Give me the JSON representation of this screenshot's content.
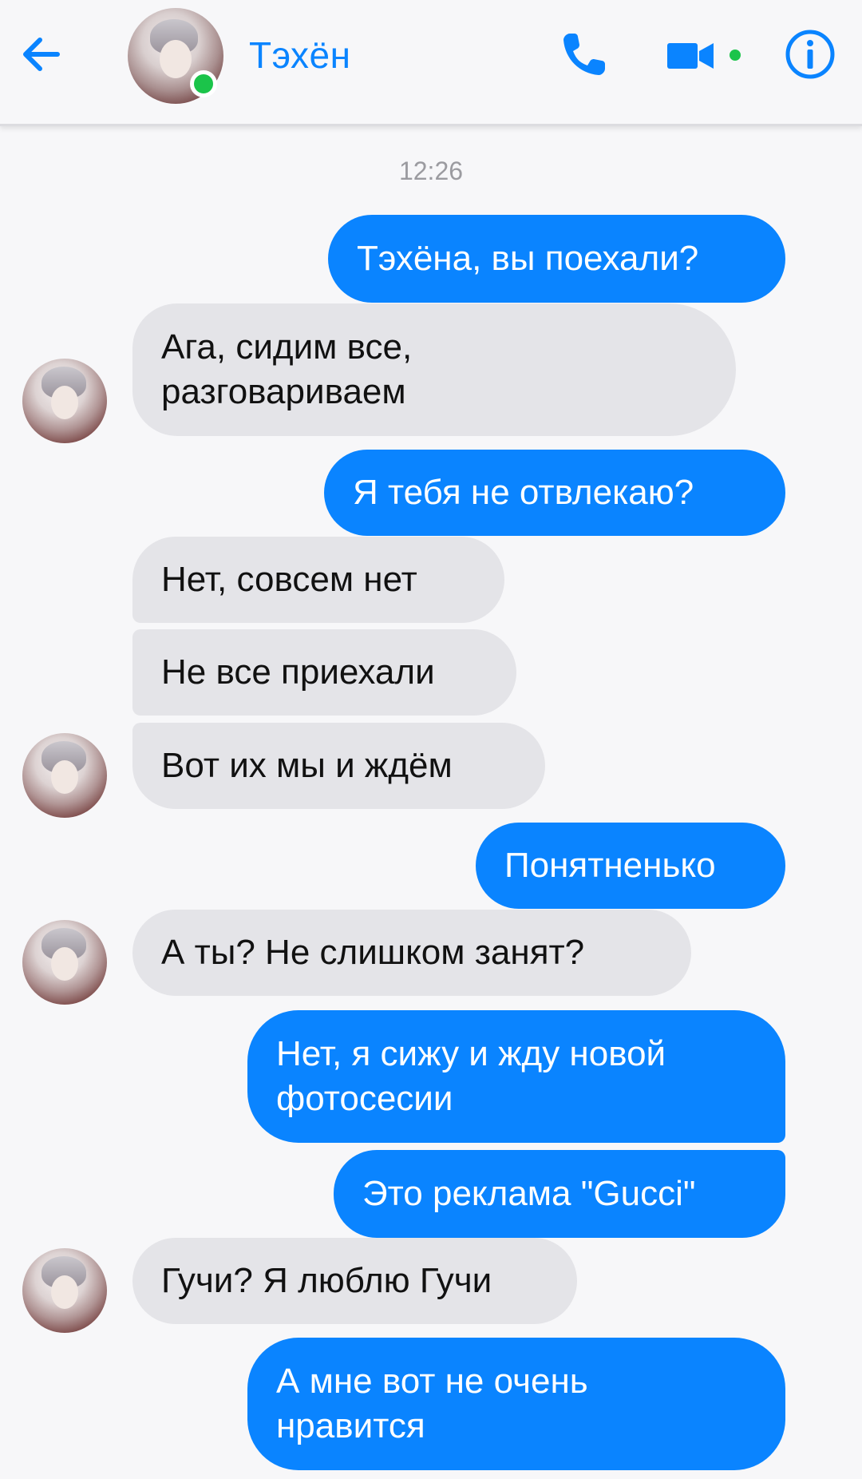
{
  "header": {
    "contact_name": "Тэхён",
    "online": true
  },
  "colors": {
    "accent": "#0a84ff",
    "outgoing_bubble": "#0a84ff",
    "incoming_bubble": "#e4e4e8",
    "online": "#1bc44a"
  },
  "icons": {
    "back": "arrow-left-icon",
    "call": "phone-icon",
    "video": "video-camera-icon",
    "info": "info-icon"
  },
  "chat": {
    "timestamp": "12:26",
    "messages": [
      {
        "from": "me",
        "text": "Тэхёна, вы поехали?"
      },
      {
        "from": "contact",
        "text": "Ага, сидим все,\nразговариваем"
      },
      {
        "from": "me",
        "text": "Я тебя не отвлекаю?"
      },
      {
        "from": "contact",
        "text": "Нет, совсем нет"
      },
      {
        "from": "contact",
        "text": "Не все приехали"
      },
      {
        "from": "contact",
        "text": "Вот их мы и ждём"
      },
      {
        "from": "me",
        "text": "Понятненько"
      },
      {
        "from": "contact",
        "text": "А ты? Не слишком занят?"
      },
      {
        "from": "me",
        "text": "Нет, я сижу и жду новой\nфотосесии"
      },
      {
        "from": "me",
        "text": "Это реклама \"Gucci\""
      },
      {
        "from": "contact",
        "text": "Гучи? Я люблю Гучи"
      },
      {
        "from": "me",
        "text": "А мне вот не очень\nнравится"
      }
    ]
  }
}
